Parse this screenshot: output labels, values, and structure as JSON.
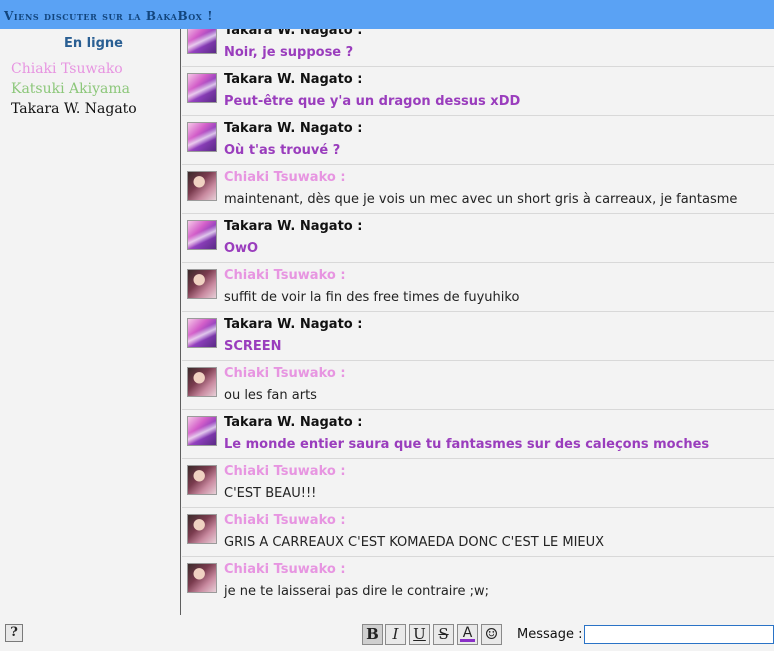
{
  "header": {
    "title": "Viens discuter sur la BakaBox !"
  },
  "online": {
    "heading": "En ligne",
    "users": [
      {
        "name": "Chiaki Tsuwako",
        "color": "#e795e1"
      },
      {
        "name": "Katsuki Akiyama",
        "color": "#8cc77a"
      },
      {
        "name": "Takara W. Nagato",
        "color": "#111111"
      }
    ]
  },
  "messages": [
    {
      "author": "Takara W. Nagato :",
      "avatar": "takara-avatar",
      "author_color": "#111111",
      "text": "Noir, je suppose ?",
      "text_color": "#9a3dbd",
      "bold": true
    },
    {
      "author": "Takara W. Nagato :",
      "avatar": "takara-avatar",
      "author_color": "#111111",
      "text": "Peut-être que y'a un dragon dessus xDD",
      "text_color": "#9a3dbd",
      "bold": true
    },
    {
      "author": "Takara W. Nagato :",
      "avatar": "takara-avatar",
      "author_color": "#111111",
      "text": "Où t'as trouvé ?",
      "text_color": "#9a3dbd",
      "bold": true
    },
    {
      "author": "Chiaki Tsuwako :",
      "avatar": "chiaki-avatar",
      "author_color": "#e795e1",
      "text": "maintenant, dès que je vois un mec avec un short gris à carreaux, je fantasme",
      "text_color": "#222222",
      "bold": false
    },
    {
      "author": "Takara W. Nagato :",
      "avatar": "takara-avatar",
      "author_color": "#111111",
      "text": "OwO",
      "text_color": "#9a3dbd",
      "bold": true
    },
    {
      "author": "Chiaki Tsuwako :",
      "avatar": "chiaki-avatar",
      "author_color": "#e795e1",
      "text": "suffit de voir la fin des free times de fuyuhiko",
      "text_color": "#222222",
      "bold": false
    },
    {
      "author": "Takara W. Nagato :",
      "avatar": "takara-avatar",
      "author_color": "#111111",
      "text": "SCREEN",
      "text_color": "#9a3dbd",
      "bold": true
    },
    {
      "author": "Chiaki Tsuwako :",
      "avatar": "chiaki-avatar",
      "author_color": "#e795e1",
      "text": "ou les fan arts",
      "text_color": "#222222",
      "bold": false
    },
    {
      "author": "Takara W. Nagato :",
      "avatar": "takara-avatar",
      "author_color": "#111111",
      "text": "Le monde entier saura que tu fantasmes sur des caleçons moches",
      "text_color": "#9a3dbd",
      "bold": true
    },
    {
      "author": "Chiaki Tsuwako :",
      "avatar": "chiaki-avatar",
      "author_color": "#e795e1",
      "text": "C'EST BEAU!!!",
      "text_color": "#222222",
      "bold": false
    },
    {
      "author": "Chiaki Tsuwako :",
      "avatar": "chiaki-avatar",
      "author_color": "#e795e1",
      "text": "GRIS A CARREAUX C'EST KOMAEDA DONC C'EST LE MIEUX",
      "text_color": "#222222",
      "bold": false
    },
    {
      "author": "Chiaki Tsuwako :",
      "avatar": "chiaki-avatar",
      "author_color": "#e795e1",
      "text": "je ne te laisserai pas dire le contraire ;w;",
      "text_color": "#222222",
      "bold": false
    }
  ],
  "toolbar": {
    "help_label": "?",
    "bold_label": "B",
    "italic_label": "I",
    "underline_label": "U",
    "strike_label": "S",
    "color_label": "A",
    "color_swatch": "#8a2fc7",
    "smiley_label": "☺",
    "message_label": "Message :",
    "message_value": ""
  }
}
